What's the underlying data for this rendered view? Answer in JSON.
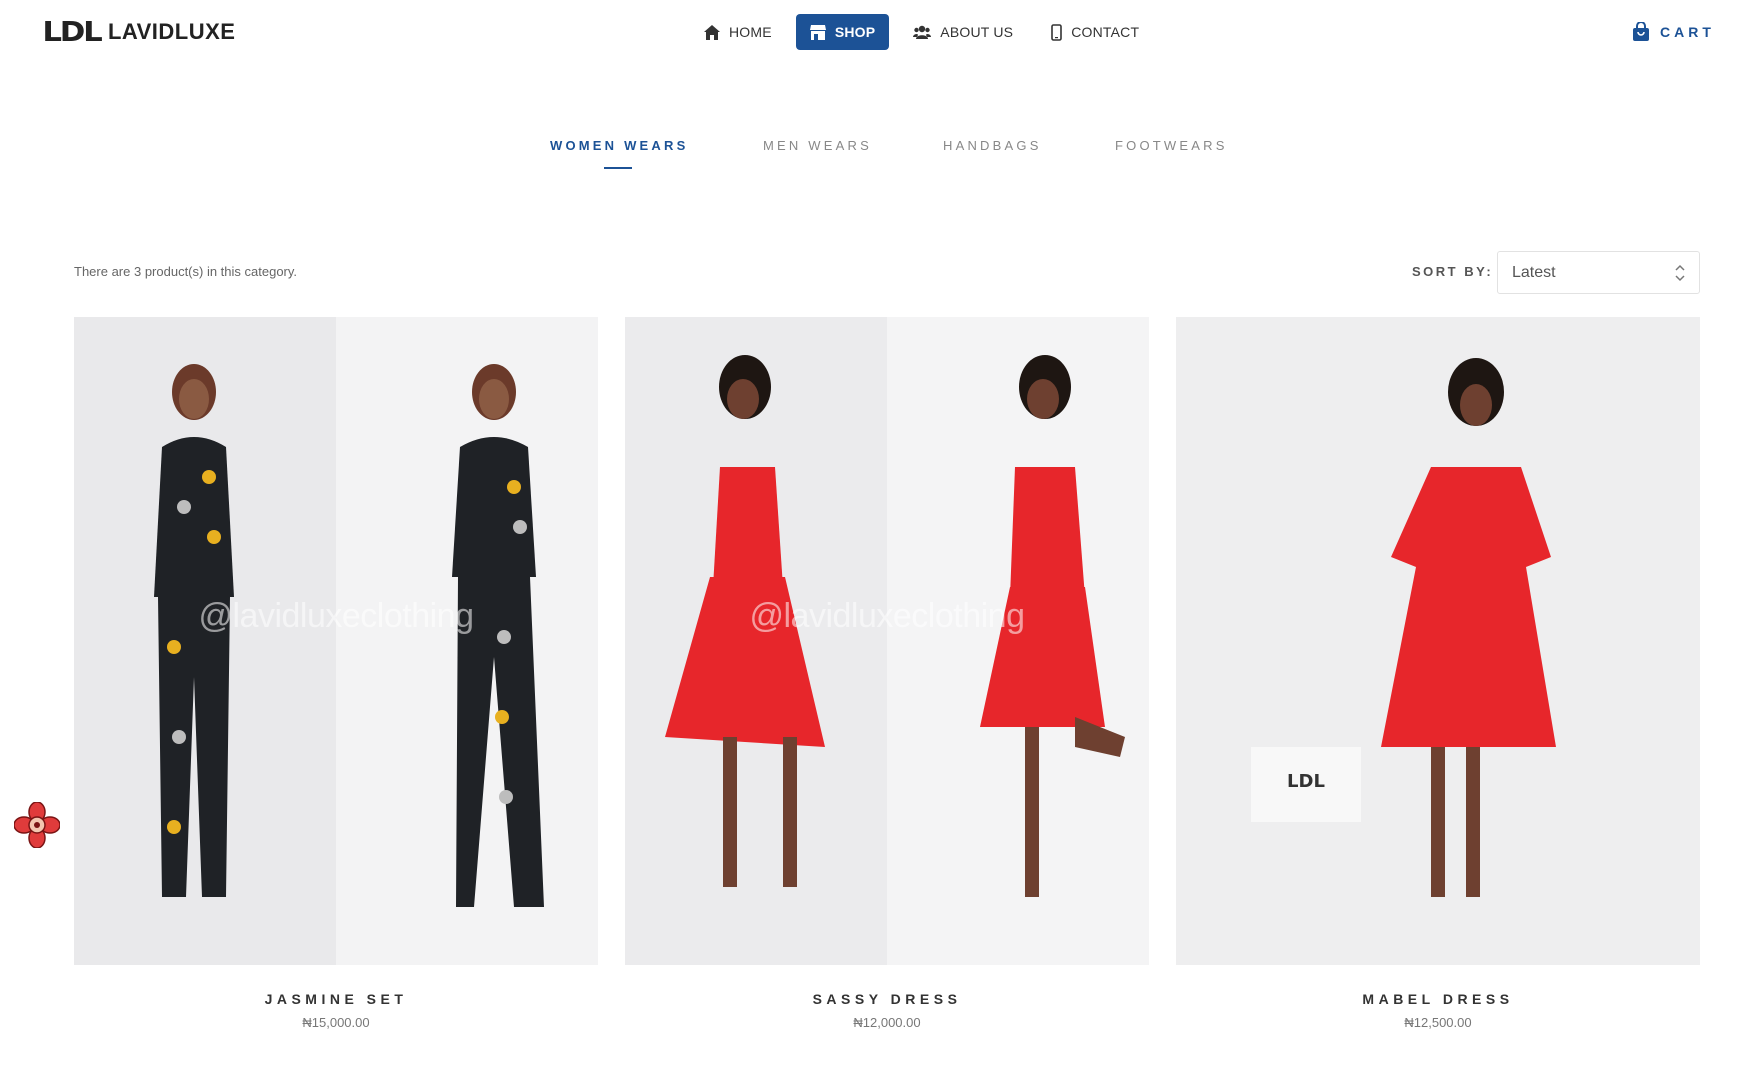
{
  "header": {
    "logo_mark": "LDL",
    "brand": "LAVIDLUXE",
    "nav": [
      {
        "label": "HOME",
        "icon": "home-icon",
        "active": false
      },
      {
        "label": "SHOP",
        "icon": "store-icon",
        "active": true
      },
      {
        "label": "ABOUT US",
        "icon": "users-icon",
        "active": false
      },
      {
        "label": "CONTACT",
        "icon": "phone-icon",
        "active": false
      }
    ],
    "cart_label": "CART",
    "cart_icon": "shopping-bag-icon"
  },
  "category_tabs": [
    {
      "label": "WOMEN WEARS",
      "active": true
    },
    {
      "label": "MEN WEARS",
      "active": false
    },
    {
      "label": "HANDBAGS",
      "active": false
    },
    {
      "label": "FOOTWEARS",
      "active": false
    }
  ],
  "toolbar": {
    "count_text": "There are 3 product(s) in this category.",
    "sort_label": "SORT BY:",
    "sort_value": "Latest"
  },
  "products": [
    {
      "name": "JASMINE SET",
      "price": "₦15,000.00",
      "watermark": "@lavidluxeclothing"
    },
    {
      "name": "SASSY DRESS",
      "price": "₦12,000.00",
      "watermark": "@lavidluxeclothing"
    },
    {
      "name": "MABEL DRESS",
      "price": "₦12,500.00",
      "watermark": ""
    }
  ],
  "colors": {
    "accent": "#1c5296",
    "badge": "#e03b3b"
  }
}
